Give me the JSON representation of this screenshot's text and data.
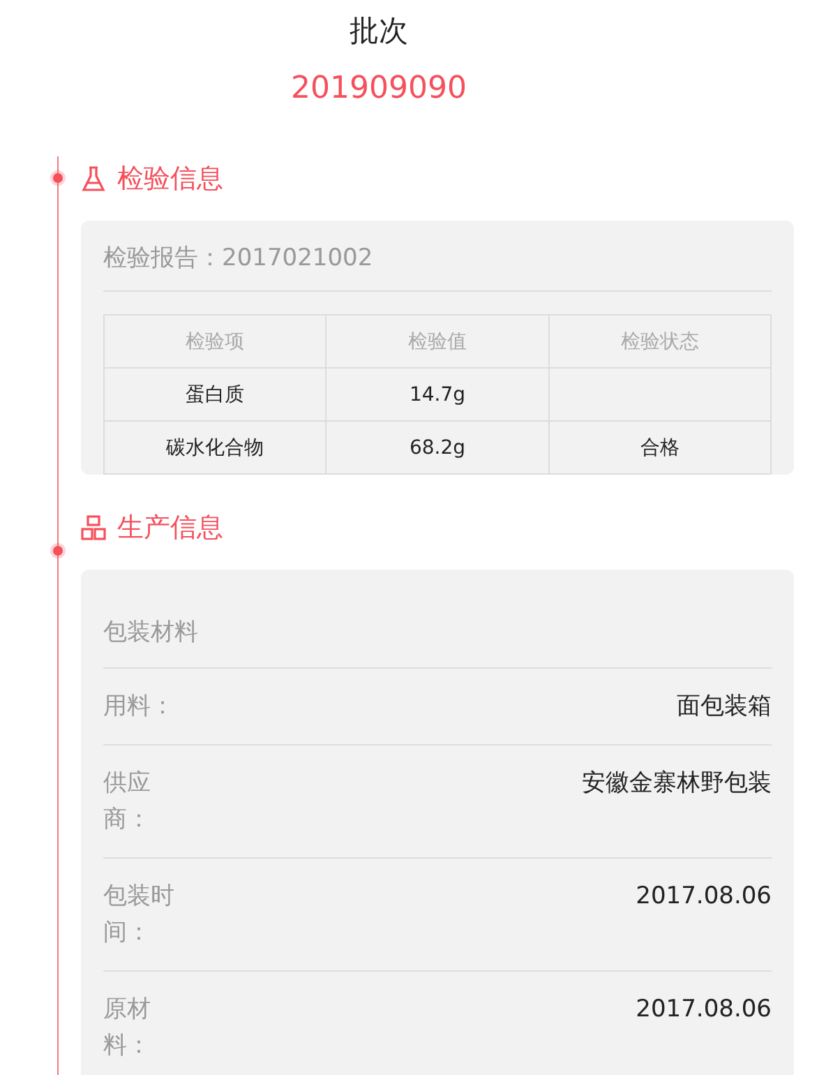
{
  "title": "批次",
  "batch_number": "201909090",
  "inspection": {
    "title": "检验信息",
    "report": "检验报告：2017021002",
    "table": {
      "columns": [
        "检验项",
        "检验值",
        "检验状态"
      ],
      "rows": [
        [
          "蛋白质",
          "14.7g",
          ""
        ],
        [
          "碳水化合物",
          "68.2g",
          "合格"
        ]
      ]
    }
  },
  "production": {
    "title": "生产信息",
    "heading": "包装材料",
    "rows": [
      {
        "label": "用料：",
        "value": "面包装箱"
      },
      {
        "label": "供应商：",
        "value": "安徽金寨林野包装"
      },
      {
        "label": "包装时间：",
        "value": "2017.08.06"
      },
      {
        "label": "原材料：",
        "value": "2017.08.06"
      }
    ]
  }
}
